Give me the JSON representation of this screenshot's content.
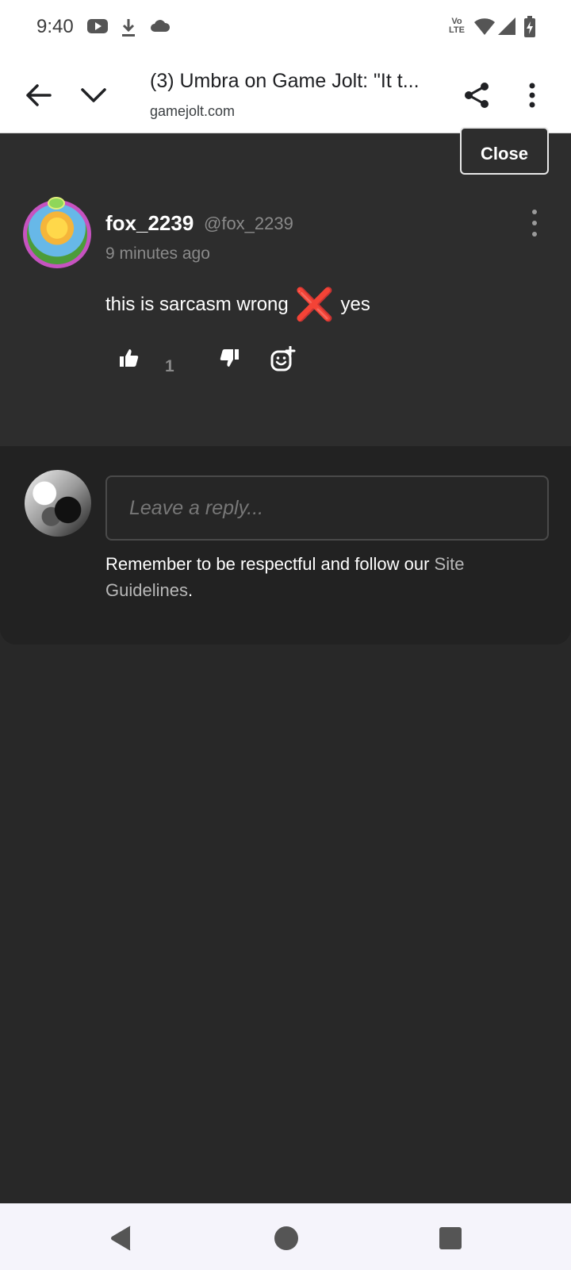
{
  "status_bar": {
    "time": "9:40",
    "left_icons": [
      "youtube-icon",
      "download-icon",
      "cloud-icon"
    ],
    "right_icons": [
      "volte-icon",
      "wifi-icon",
      "signal-icon",
      "battery-charging-icon"
    ],
    "volte_label": "Vo LTE"
  },
  "browser": {
    "title": "(3) Umbra on Game Jolt: \"It t...",
    "url": "gamejolt.com"
  },
  "panel": {
    "close_label": "Close"
  },
  "comment": {
    "username": "fox_2239",
    "handle": "@fox_2239",
    "timestamp": "9 minutes ago",
    "text_before": "this is sarcasm wrong",
    "emoji": "❌",
    "text_after": "yes",
    "like_count": "1"
  },
  "reply": {
    "placeholder": "Leave a reply...",
    "guidelines_text": "Remember to be respectful and follow our ",
    "guidelines_link": "Site Guidelines",
    "guidelines_end": "."
  },
  "colors": {
    "background": "#282828",
    "panel": "#2d2d2d",
    "reply_panel": "#222222",
    "accent_red": "#e0243c",
    "avatar_ring": "#c653c0"
  }
}
